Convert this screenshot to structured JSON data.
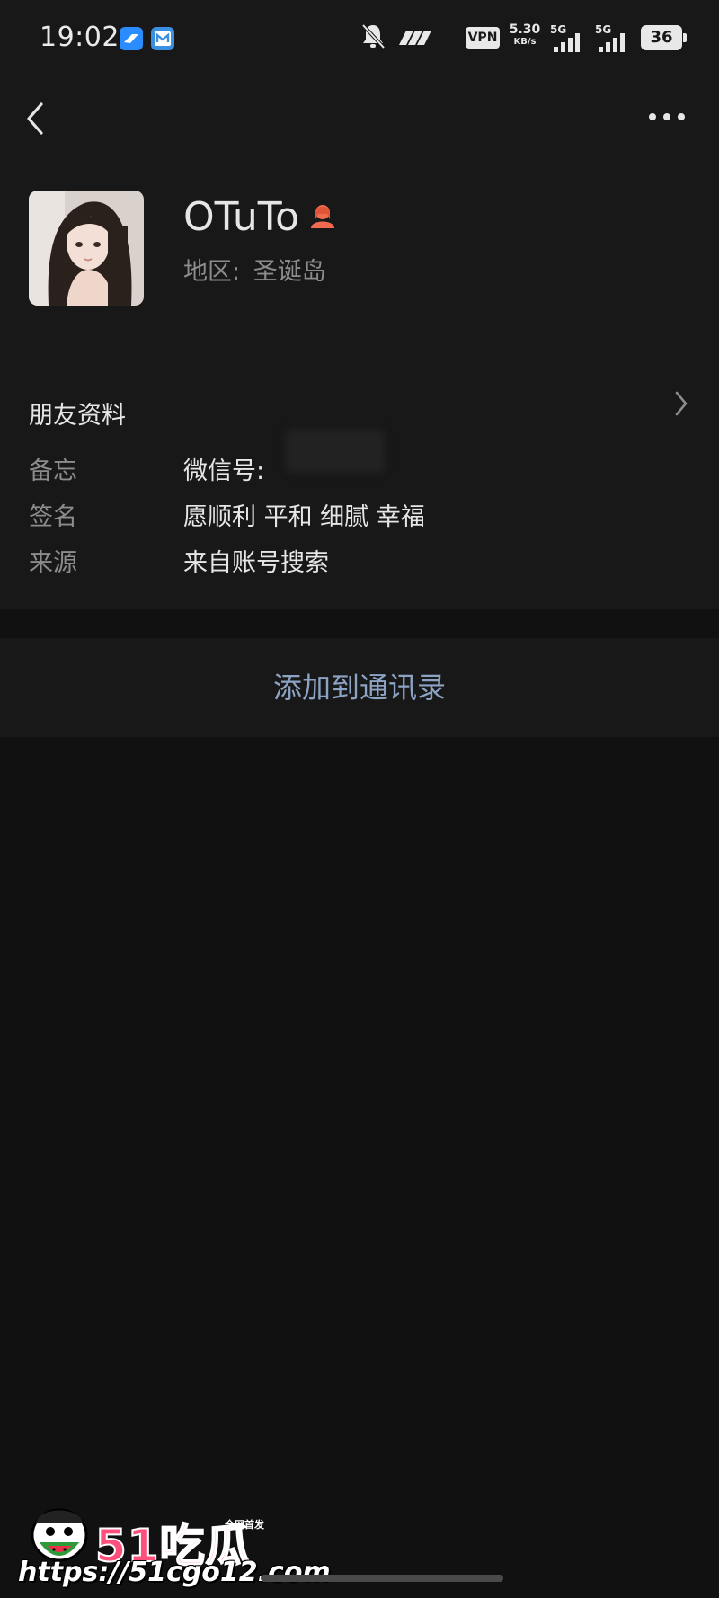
{
  "status_bar": {
    "time": "19:02",
    "notifications": [
      "feishu-icon",
      "mail-icon"
    ],
    "vpn_label": "VPN",
    "net_speed_value": "5.30",
    "net_speed_unit": "KB/s",
    "signal_1_label": "5G",
    "signal_2_label": "5G",
    "battery_level": "36"
  },
  "nav": {
    "back_icon": "chevron-left-icon",
    "more_icon": "more-horizontal-icon"
  },
  "profile": {
    "nickname": "OTuTo",
    "gender_icon": "female-icon",
    "region_label": "地区:",
    "region_value": "圣诞岛"
  },
  "section": {
    "title": "朋友资料",
    "rows": [
      {
        "label": "备忘",
        "value": "微信号:"
      },
      {
        "label": "签名",
        "value": "愿顺利 平和 细腻 幸福"
      },
      {
        "label": "来源",
        "value": "来自账号搜索"
      }
    ]
  },
  "actions": {
    "add_contact_label": "添加到通讯录"
  },
  "watermark": {
    "brand": "51吃瓜",
    "tag": "全网首发",
    "url": "https://51cgo12.com"
  },
  "colors": {
    "background": "#111111",
    "card": "#181818",
    "link": "#8ca3c4",
    "secondary_text": "#8c8c8c",
    "gender_female": "#f06a4f",
    "watermark_accent": "#ff4f7d"
  }
}
